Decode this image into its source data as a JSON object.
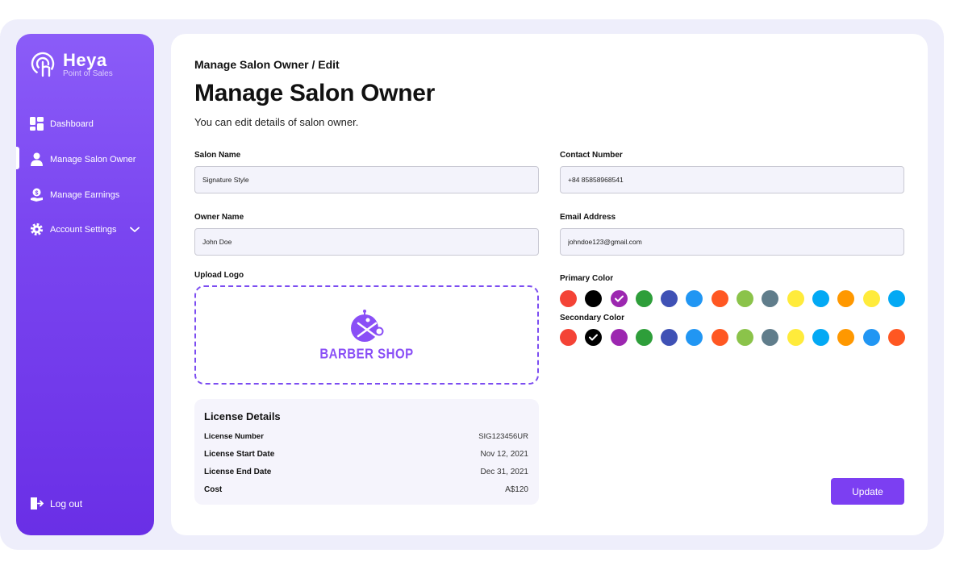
{
  "brand": {
    "name": "Heya",
    "tagline": "Point of Sales"
  },
  "sidebar": {
    "items": [
      {
        "label": "Dashboard",
        "icon": "dashboard-icon"
      },
      {
        "label": "Manage Salon Owner",
        "icon": "user-icon"
      },
      {
        "label": "Manage Earnings",
        "icon": "earnings-icon"
      },
      {
        "label": "Account Settings",
        "icon": "gear-icon"
      }
    ],
    "logout": "Log out",
    "active": "Manage Salon Owner"
  },
  "header": {
    "breadcrumb": "Manage Salon Owner / Edit",
    "title": "Manage Salon Owner",
    "subtitle": "You can edit details of salon owner."
  },
  "form": {
    "salon_name_label": "Salon Name",
    "salon_name_value": "Signature Style",
    "contact_label": "Contact Number",
    "contact_value": "+84 85858968541",
    "owner_label": "Owner Name",
    "owner_value": "John Doe",
    "email_label": "Email Address",
    "email_value": "johndoe123@gmail.com",
    "upload_label": "Upload Logo",
    "logo_text": "BARBER SHOP",
    "primary_label": "Primary Color",
    "secondary_label": "Secondary Color"
  },
  "primary_colors": [
    "#f44336",
    "#000000",
    "#9c27b0",
    "#2e9e3a",
    "#3f51b5",
    "#2196f3",
    "#ff5722",
    "#8bc34a",
    "#607d8b",
    "#ffeb3b",
    "#03a9f4",
    "#ff9800",
    "#ffeb3b",
    "#03a9f4"
  ],
  "primary_selected": 2,
  "secondary_colors": [
    "#f44336",
    "#000000",
    "#9c27b0",
    "#2e9e3a",
    "#3f51b5",
    "#2196f3",
    "#ff5722",
    "#8bc34a",
    "#607d8b",
    "#ffeb3b",
    "#03a9f4",
    "#ff9800",
    "#2196f3",
    "#ff5722"
  ],
  "secondary_selected": 1,
  "license": {
    "title": "License Details",
    "number_label": "License Number",
    "number_value": "SIG123456UR",
    "start_label": "License Start Date",
    "start_value": "Nov 12, 2021",
    "end_label": "License End Date",
    "end_value": "Dec 31, 2021",
    "cost_label": "Cost",
    "cost_value": "A$120"
  },
  "actions": {
    "update_label": "Update"
  },
  "accent": "#7c3ff2"
}
